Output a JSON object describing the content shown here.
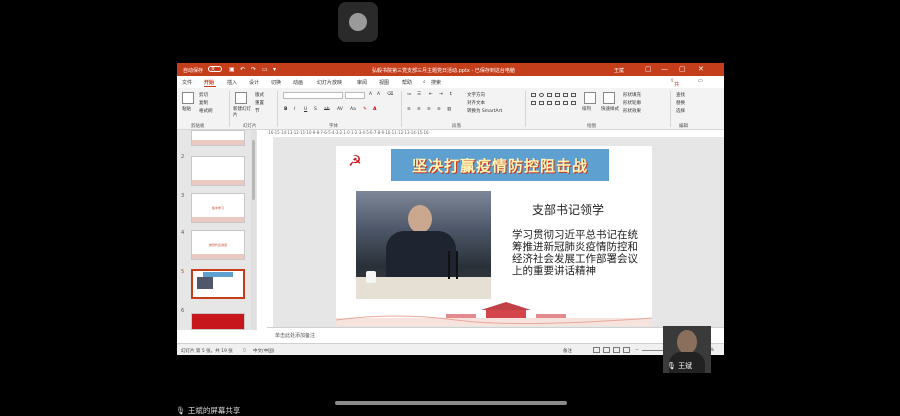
{
  "titlebar": {
    "autosave": "自动保存",
    "autosave_state": "关",
    "doc_title": "弘毅书院第三党支部三月主题党日活动.pptx - 已保存到这台电脑",
    "user": "王斌"
  },
  "tabs": [
    "文件",
    "开始",
    "插入",
    "设计",
    "切换",
    "动画",
    "幻灯片放映",
    "审阅",
    "视图",
    "帮助"
  ],
  "search_label": "搜索",
  "share_label": "共享",
  "ribbon": {
    "clipboard": {
      "paste": "粘贴",
      "cut": "剪切",
      "copy": "复制",
      "format_painter": "格式刷",
      "group": "剪贴板"
    },
    "slides": {
      "new_slide": "新建幻灯片",
      "layout": "版式",
      "reset": "重置",
      "section": "节",
      "group": "幻灯片"
    },
    "font": {
      "group": "字体",
      "bold": "B",
      "italic": "I",
      "underline": "U",
      "strike": "S",
      "shadow": "ab",
      "spacing": "AV",
      "case": "Aa",
      "color": "A"
    },
    "paragraph": {
      "group": "段落",
      "text_direction": "文字方向",
      "align_text": "对齐文本",
      "smartart": "转换为 SmartArt"
    },
    "drawing": {
      "group": "绘图",
      "arrange": "排列",
      "quick_styles": "快速样式",
      "fill": "形状填充",
      "outline": "形状轮廓",
      "effects": "形状效果"
    },
    "editing": {
      "group": "编辑",
      "find": "查找",
      "replace": "替换",
      "select": "选择"
    }
  },
  "ruler_text": "·16·15·14·13·12·11·10·9·8·7·6·5·4·3·2·1·0·1·2·3·4·5·6·7·8·9·10·11·12·13·14·15·16·",
  "thumbnails": [
    {
      "num": "1",
      "title": ""
    },
    {
      "num": "2",
      "title": ""
    },
    {
      "num": "3",
      "title": "集中学习"
    },
    {
      "num": "4",
      "title": "党员代表讲话"
    },
    {
      "num": "5",
      "title": ""
    },
    {
      "num": "6",
      "title": ""
    }
  ],
  "slide": {
    "banner": "坚决打赢疫情防控阻击战",
    "subtitle": "支部书记领学",
    "body": "学习贯彻习近平总书记在统筹推进新冠肺炎疫情防控和经济社会发展工作部署会议上的重要讲话精神"
  },
  "notes_placeholder": "单击此处添加备注",
  "status": {
    "slide_info": "幻灯片 第 5 张，共 19 张",
    "language": "中文(中国)",
    "notes": "备注",
    "zoom": "62%"
  },
  "participant": {
    "name": "王斌"
  },
  "share_label_bottom": "王斌的屏幕共享",
  "colors": {
    "ppt_accent": "#c43e1c",
    "banner": "#5ea0cf",
    "emblem": "#c8161d"
  }
}
